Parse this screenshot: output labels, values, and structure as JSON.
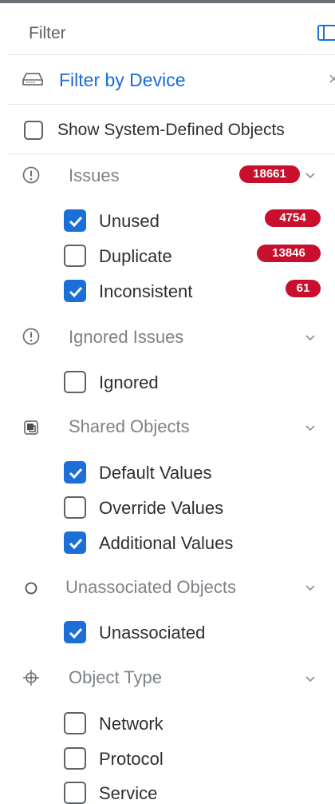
{
  "header": {
    "title": "Filter",
    "panel_icon": "panel-toggle-icon"
  },
  "filter_by_device": {
    "label": "Filter by Device",
    "close": "×",
    "icon": "device-icon"
  },
  "system_defined": {
    "label": "Show System-Defined Objects",
    "checked": false
  },
  "sections": {
    "issues": {
      "label": "Issues",
      "count": "18661",
      "icon": "exclamation-circle-icon",
      "items": [
        {
          "label": "Unused",
          "checked": true,
          "count": "4754"
        },
        {
          "label": "Duplicate",
          "checked": false,
          "count": "13846"
        },
        {
          "label": "Inconsistent",
          "checked": true,
          "count": "61"
        }
      ]
    },
    "ignored_issues": {
      "label": "Ignored Issues",
      "icon": "exclamation-circle-icon",
      "items": [
        {
          "label": "Ignored",
          "checked": false
        }
      ]
    },
    "shared_objects": {
      "label": "Shared Objects",
      "icon": "shared-objects-icon",
      "items": [
        {
          "label": "Default Values",
          "checked": true
        },
        {
          "label": "Override Values",
          "checked": false
        },
        {
          "label": "Additional Values",
          "checked": true
        }
      ]
    },
    "unassociated_objects": {
      "label": "Unassociated Objects",
      "icon": "circle-icon",
      "items": [
        {
          "label": "Unassociated",
          "checked": true
        }
      ]
    },
    "object_type": {
      "label": "Object Type",
      "icon": "object-type-icon",
      "items": [
        {
          "label": "Network",
          "checked": false
        },
        {
          "label": "Protocol",
          "checked": false
        },
        {
          "label": "Service",
          "checked": false
        }
      ]
    }
  },
  "colors": {
    "accent": "#1c6fd7",
    "badge": "#c8102e",
    "link": "#1a6bd8"
  }
}
